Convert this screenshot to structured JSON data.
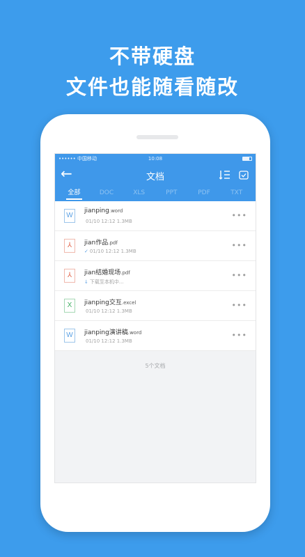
{
  "headline": {
    "line1": "不带硬盘",
    "line2": "文件也能随看随改"
  },
  "statusbar": {
    "carrier": "•••••• 中国移动",
    "time": "10:08"
  },
  "navbar": {
    "back_icon": "back-arrow-icon",
    "title": "文档",
    "sort_icon": "sort-list-icon",
    "select_icon": "select-check-icon"
  },
  "tabs": [
    {
      "label": "全部",
      "active": true
    },
    {
      "label": "DOC",
      "active": false
    },
    {
      "label": "XLS",
      "active": false
    },
    {
      "label": "PPT",
      "active": false
    },
    {
      "label": "PDF",
      "active": false
    },
    {
      "label": "TXT",
      "active": false
    }
  ],
  "files": [
    {
      "name": "jianping",
      "ext": ".word",
      "type": "word",
      "glyph": "W",
      "meta": "01/10 12:12   1.3MB",
      "status": ""
    },
    {
      "name": "jian作品",
      "ext": ".pdf",
      "type": "pdf",
      "glyph": "⅄",
      "meta": "01/10 12:12   1.3MB",
      "status": "✓"
    },
    {
      "name": "jian结婚现场",
      "ext": ".pdf",
      "type": "pdf",
      "glyph": "⅄",
      "meta": "下载至本机中...",
      "status": "↓"
    },
    {
      "name": "jianping交互",
      "ext": ".excel",
      "type": "excel",
      "glyph": "X",
      "meta": "01/10 12:12   1.3MB",
      "status": ""
    },
    {
      "name": "jianping演讲稿",
      "ext": ".word",
      "type": "word",
      "glyph": "W",
      "meta": "01/10 12:12   1.3MB",
      "status": ""
    }
  ],
  "more_label": "•••",
  "count_text": "5个文档",
  "colors": {
    "background": "#3d9cec",
    "app_bar": "#3f98ea",
    "word": "#5aa0e4",
    "pdf": "#e2664c",
    "excel": "#3fae62"
  }
}
